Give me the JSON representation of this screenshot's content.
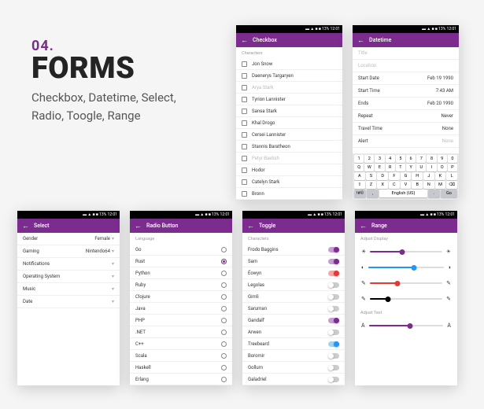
{
  "hero": {
    "number": "04.",
    "title": "FORMS",
    "subtitle": "Checkbox, Datetime, Select, Radio, Toogle, Range"
  },
  "statusbar_text": "▬ ▲ ■ ■ 13% 12:01",
  "checkbox": {
    "title": "Checkbox",
    "section": "Characters",
    "items": [
      {
        "label": "Jon Snow",
        "checked": false,
        "muted": false
      },
      {
        "label": "Daenerys Targaryen",
        "checked": false,
        "muted": false
      },
      {
        "label": "Arya Stark",
        "checked": false,
        "muted": true
      },
      {
        "label": "Tyrion Lannister",
        "checked": false,
        "muted": false
      },
      {
        "label": "Sansa Stark",
        "checked": false,
        "muted": false
      },
      {
        "label": "Khal Drogo",
        "checked": false,
        "muted": false
      },
      {
        "label": "Cersei Lannister",
        "checked": false,
        "muted": false
      },
      {
        "label": "Stannis Baratheon",
        "checked": false,
        "muted": false
      },
      {
        "label": "Petyr Baelish",
        "checked": false,
        "muted": true
      },
      {
        "label": "Hodor",
        "checked": false,
        "muted": false
      },
      {
        "label": "Catelyn Stark",
        "checked": false,
        "muted": false
      },
      {
        "label": "Bronn",
        "checked": false,
        "muted": false
      }
    ]
  },
  "datetime": {
    "title": "Datetime",
    "section": "Title",
    "location": "Location",
    "rows": [
      {
        "label": "Start Date",
        "value": "Feb 19 1990"
      },
      {
        "label": "Start Time",
        "value": "7:43 AM"
      },
      {
        "label": "Ends",
        "value": "Feb 20 1990"
      },
      {
        "label": "Repeat",
        "value": "Never"
      },
      {
        "label": "Travel Time",
        "value": "None"
      }
    ],
    "alert": {
      "label": "Alert",
      "value": "None"
    }
  },
  "keyboard": {
    "row_nums": [
      "1",
      "2",
      "3",
      "4",
      "5",
      "6",
      "7",
      "8",
      "9",
      "0"
    ],
    "row1": [
      "Q",
      "W",
      "E",
      "R",
      "T",
      "Y",
      "U",
      "I",
      "O",
      "P"
    ],
    "row2": [
      "A",
      "S",
      "D",
      "F",
      "G",
      "H",
      "J",
      "K",
      "L"
    ],
    "row3": [
      "⇧",
      "Z",
      "X",
      "C",
      "V",
      "B",
      "N",
      "M",
      "⌫"
    ],
    "row4_sym": "!#©",
    "row4_lang": "English (US)",
    "row4_go": "Go"
  },
  "select": {
    "title": "Select",
    "rows": [
      {
        "label": "Gender",
        "value": "Female"
      },
      {
        "label": "Gaming",
        "value": "Nintendo64"
      },
      {
        "label": "Notifications",
        "value": ""
      },
      {
        "label": "Operating System",
        "value": ""
      },
      {
        "label": "Music",
        "value": ""
      },
      {
        "label": "Date",
        "value": ""
      }
    ]
  },
  "radio": {
    "title": "Radio Button",
    "section": "Language",
    "items": [
      {
        "label": "Go",
        "sel": false
      },
      {
        "label": "Rust",
        "sel": true
      },
      {
        "label": "Python",
        "sel": false
      },
      {
        "label": "Ruby",
        "sel": false
      },
      {
        "label": "Clojure",
        "sel": false
      },
      {
        "label": "Java",
        "sel": false
      },
      {
        "label": "PHP",
        "sel": false
      },
      {
        "label": ".NET",
        "sel": false
      },
      {
        "label": "C++",
        "sel": false
      },
      {
        "label": "Scala",
        "sel": false
      },
      {
        "label": "Haskell",
        "sel": false
      },
      {
        "label": "Erlang",
        "sel": false
      }
    ]
  },
  "toggle": {
    "title": "Toggle",
    "section": "Characters",
    "items": [
      {
        "label": "Frodo Baggins",
        "on": true,
        "color": ""
      },
      {
        "label": "Sam",
        "on": true,
        "color": ""
      },
      {
        "label": "Éowyn",
        "on": true,
        "color": "red"
      },
      {
        "label": "Legolas",
        "on": false,
        "color": ""
      },
      {
        "label": "Gimli",
        "on": false,
        "color": ""
      },
      {
        "label": "Saruman",
        "on": false,
        "color": ""
      },
      {
        "label": "Gandalf",
        "on": true,
        "color": ""
      },
      {
        "label": "Arwen",
        "on": false,
        "color": ""
      },
      {
        "label": "Treebeard",
        "on": true,
        "color": "blue"
      },
      {
        "label": "Boromir",
        "on": false,
        "color": ""
      },
      {
        "label": "Gollum",
        "on": false,
        "color": ""
      },
      {
        "label": "Galadriel",
        "on": false,
        "color": ""
      }
    ]
  },
  "range": {
    "title": "Range",
    "section1": "Adjust Display",
    "section2": "Adjust Text",
    "sliders": [
      {
        "iconL": "☀",
        "iconR": "☀",
        "fill": 45,
        "color": "#7b2c8e"
      },
      {
        "iconL": "◐",
        "iconR": "◑",
        "fill": 60,
        "color": "#2196f3"
      },
      {
        "iconL": "✎",
        "iconR": "✎",
        "fill": 38,
        "color": "#e53935"
      },
      {
        "iconL": "✎",
        "iconR": "✎",
        "fill": 25,
        "color": "#000"
      }
    ],
    "textSlider": {
      "iconL": "A",
      "iconR": "A",
      "fill": 55,
      "color": "#7b2c8e"
    }
  }
}
